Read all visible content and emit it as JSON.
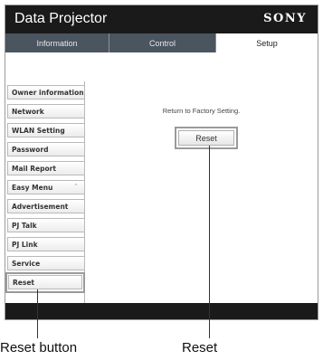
{
  "header": {
    "title": "Data Projector",
    "brand": "SONY"
  },
  "tabs": [
    {
      "label": "Information",
      "active": false
    },
    {
      "label": "Control",
      "active": false
    },
    {
      "label": "Setup",
      "active": true
    }
  ],
  "sidebar": {
    "items": [
      {
        "label": "Owner information"
      },
      {
        "label": "Network"
      },
      {
        "label": "WLAN Setting"
      },
      {
        "label": "Password"
      },
      {
        "label": "Mail Report"
      },
      {
        "label": "Easy Menu",
        "icon": "chevron-up-double-icon",
        "icon_glyph": "⌃"
      },
      {
        "label": "Advertisement"
      },
      {
        "label": "PJ Talk"
      },
      {
        "label": "PJ Link"
      },
      {
        "label": "Service"
      },
      {
        "label": "Reset",
        "selected": true
      }
    ]
  },
  "main": {
    "message": "Return to Factory Setting.",
    "reset_button": "Reset"
  },
  "callouts": {
    "reset_button": "Reset button",
    "reset": "Reset"
  },
  "colors": {
    "header_bg": "#1a1a1a",
    "tab_bg": "#4a5560",
    "active_tab_bg": "#ffffff",
    "highlight_border": "#9a9a9a"
  }
}
